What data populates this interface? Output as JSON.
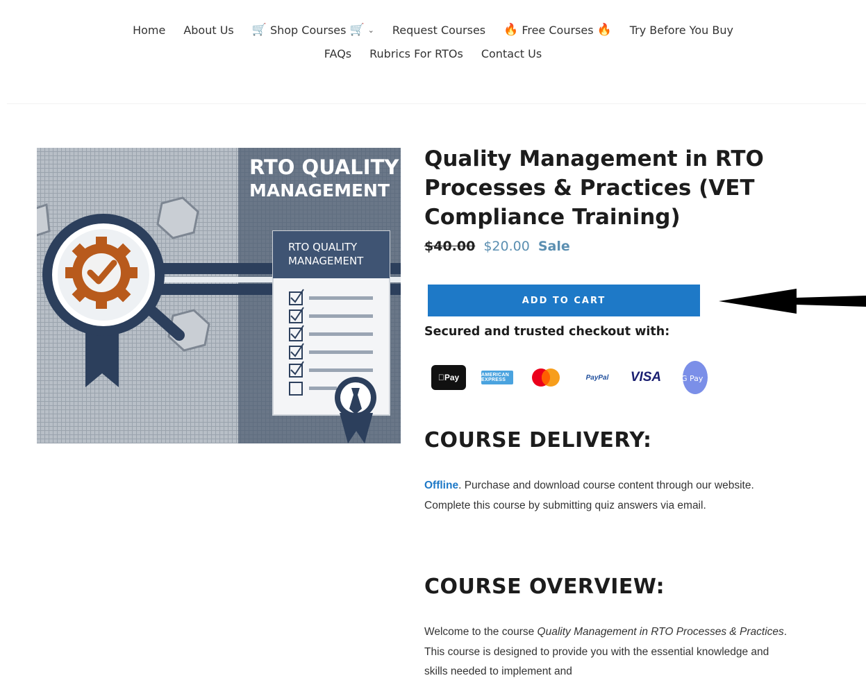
{
  "nav": {
    "row1": {
      "home": "Home",
      "about": "About Us",
      "shop": "Shop Courses",
      "request": "Request Courses",
      "free": "Free Courses",
      "try": "Try Before You Buy"
    },
    "row2": {
      "faqs": "FAQs",
      "rubrics": "Rubrics For RTOs",
      "contact": "Contact Us"
    },
    "emoji": {
      "cart": "🛒",
      "fire": "🔥"
    }
  },
  "product_image": {
    "headline_line1": "RTO QUALITY",
    "headline_line2": "MANAGEMENT",
    "doc_line1": "RTO QUALITY",
    "doc_line2": "MANAGEMENT"
  },
  "product": {
    "title": "Quality Management in RTO Processes & Practices (VET Compliance Training)",
    "price_old": "$40.00",
    "price_new": "$20.00",
    "sale_label": "Sale",
    "add_to_cart": "ADD TO CART",
    "secured": "Secured and trusted checkout with:"
  },
  "payments": {
    "apple": "Pay",
    "amex": "AMERICAN EXPRESS",
    "paypal": "PayPal",
    "visa": "VISA",
    "gpay": "G Pay"
  },
  "delivery": {
    "heading": "COURSE DELIVERY:",
    "link": "Offline",
    "text": ". Purchase and download course content through our website. Complete this course by submitting quiz answers via email."
  },
  "overview": {
    "heading": "COURSE OVERVIEW:",
    "text1": "Welcome to the course ",
    "em": "Quality Management in RTO Processes & Practices",
    "text2": ". This course is designed to provide you with the essential knowledge and skills needed to implement and"
  },
  "colors": {
    "accent": "#1e79c7",
    "sale": "#5b8fb1",
    "image_navy": "#2f4a6e"
  }
}
